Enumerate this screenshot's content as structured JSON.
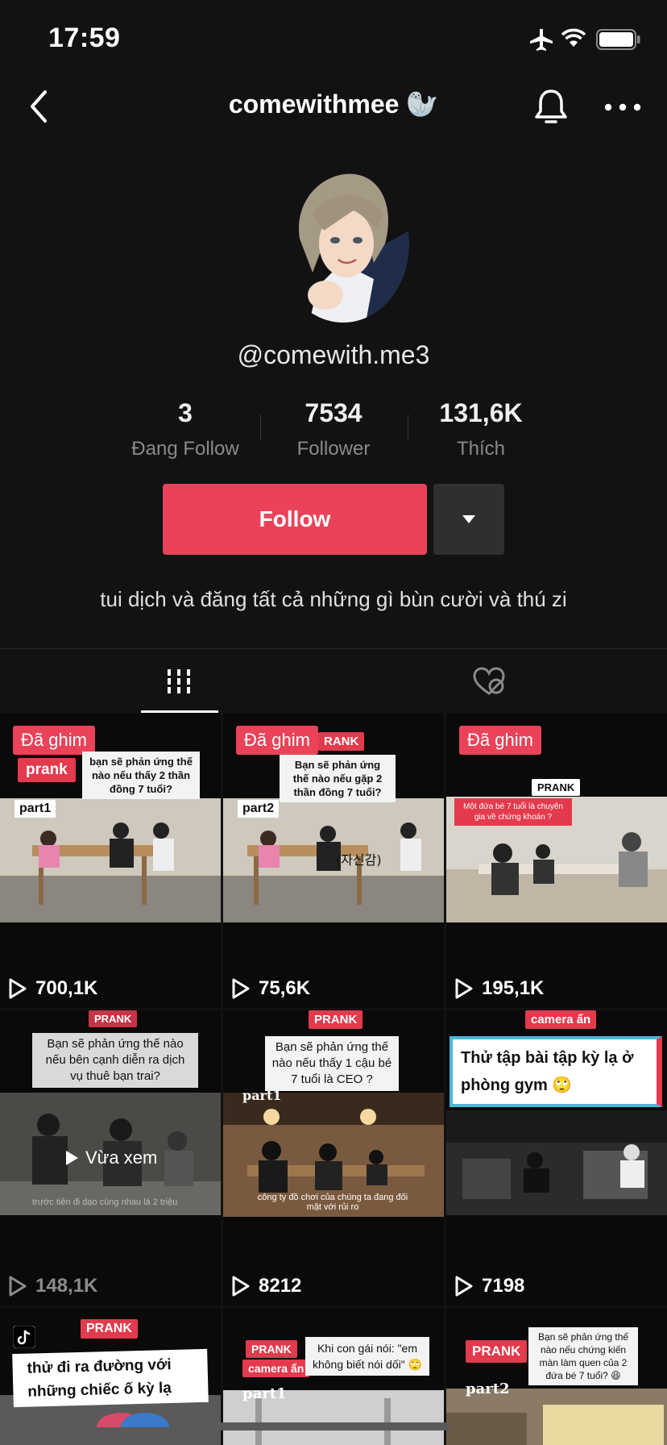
{
  "status_bar": {
    "time": "17:59"
  },
  "nav": {
    "title": "comewithmee 🦭"
  },
  "profile": {
    "handle": "@comewith.me3",
    "stats": [
      {
        "value": "3",
        "label": "Đang Follow"
      },
      {
        "value": "7534",
        "label": "Follower"
      },
      {
        "value": "131,6K",
        "label": "Thích"
      }
    ],
    "follow_label": "Follow",
    "bio": "tui dịch và đăng tất cả những gì bùn cười và thú zi"
  },
  "colors": {
    "accent": "#ea4359",
    "background": "#121212"
  },
  "videos": [
    {
      "pinned": "Đã ghim",
      "tag": "prank",
      "caption": "bạn sẽ phản ứng thế nào nếu thấy 2 thần đồng 7 tuổi?",
      "part": "part1",
      "views": "700,1K"
    },
    {
      "pinned": "Đã ghim",
      "tag": "RANK",
      "caption": "Bạn sẽ phản ứng thế nào nếu gặp 2 thần đồng 7 tuổi?",
      "part": "part2",
      "views": "75,6K"
    },
    {
      "pinned": "Đã ghim",
      "tag": "PRANK",
      "caption": "Một đứa bé 7 tuổi là chuyên gia về chứng khoán ?",
      "views": "195,1K"
    },
    {
      "tag": "PRANK",
      "caption": "Bạn sẽ phản ứng thế nào nếu bên cạnh diễn ra dịch vụ thuê bạn trai?",
      "watched": "Vừa xem",
      "sub": "trước tiên đi dạo cùng nhau là 2 triệu",
      "views": "148,1K"
    },
    {
      "tag": "PRANK",
      "caption": "Bạn sẽ phản ứng thế nào nếu thấy 1 cậu bé 7 tuổi là CEO ?",
      "part": "part1",
      "sub": "công ty đồ chơi của chúng ta đang đối mặt với rủi ro",
      "views": "8212"
    },
    {
      "tag": "camera ẩn",
      "caption": "Thử tập bài tập kỳ lạ ở phòng gym 🙄",
      "views": "7198"
    },
    {
      "tag": "PRANK",
      "caption": "thử đi ra đường với những chiếc ố kỳ lạ"
    },
    {
      "tag": "PRANK",
      "tag2": "camera ẩn",
      "caption": "Khi con gái nói: \"em không biết nói dối\" 🙄",
      "part": "part1"
    },
    {
      "tag": "PRANK",
      "caption": "Bạn sẽ phản ứng thế nào nếu chứng kiến màn làm quen của 2 đứa bé 7 tuổi? 😆",
      "part": "part2"
    }
  ]
}
